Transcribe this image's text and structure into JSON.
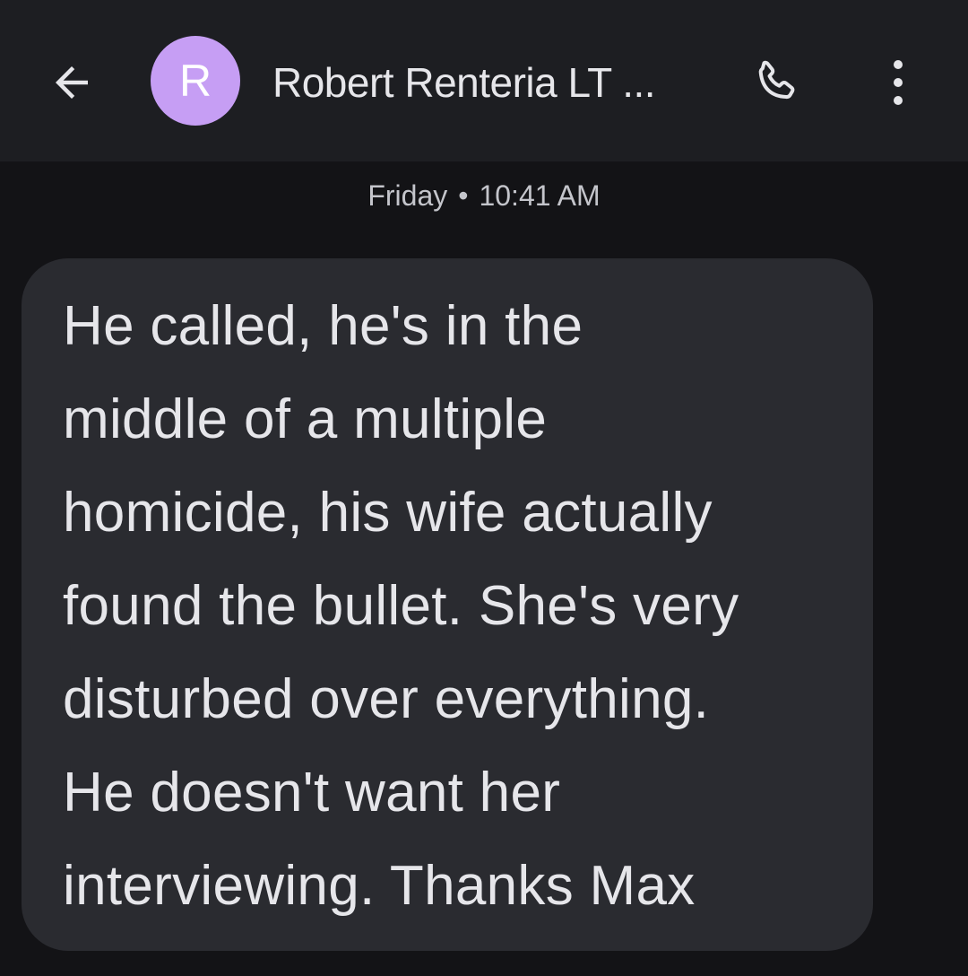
{
  "header": {
    "back_icon": "arrow-back-icon",
    "avatar_initial": "R",
    "avatar_color": "#c69ef4",
    "contact_name": "Robert Renteria LT ...",
    "call_icon": "phone-icon",
    "more_icon": "more-vert-icon"
  },
  "conversation": {
    "day": "Friday",
    "time": "10:41 AM",
    "message": {
      "lines": [
        "He called, he's in the",
        "middle of a multiple",
        "homicide, his wife actually",
        "found the bullet. She's very",
        "disturbed over everything.",
        "He doesn't want her",
        "interviewing. Thanks Max"
      ]
    }
  }
}
